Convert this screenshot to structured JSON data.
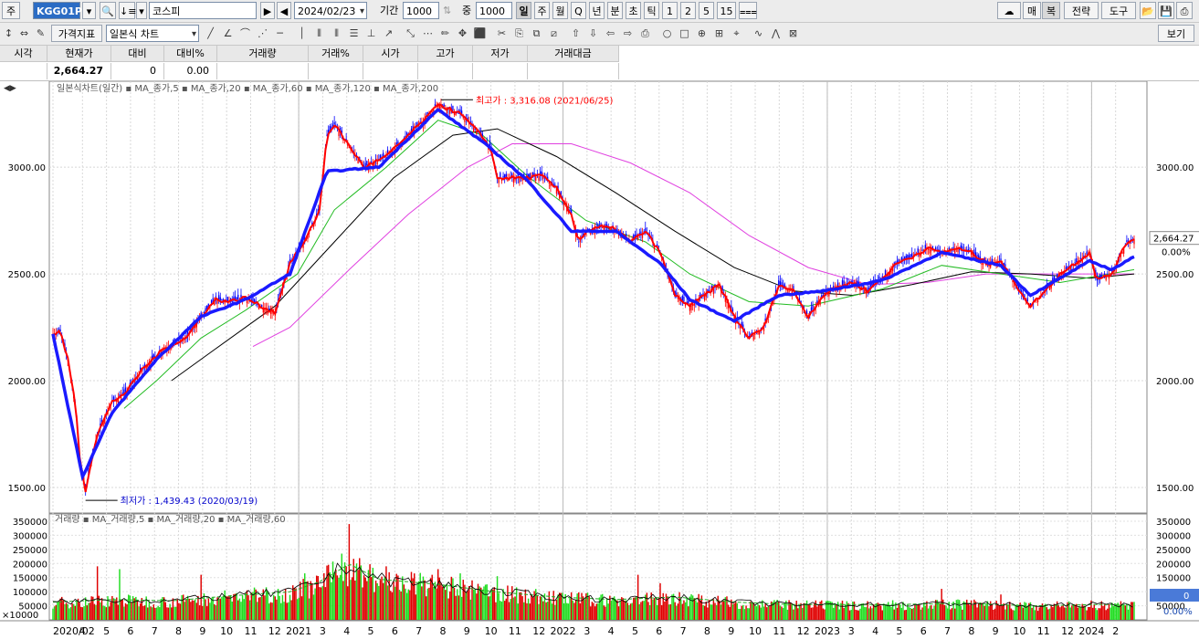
{
  "toolbar": {
    "market_label": "주",
    "code": "KGG01P",
    "name": "코스피",
    "date": "2024/02/23",
    "period_label": "기간",
    "period_value": "1000",
    "count_label": "중",
    "count_value": "1000",
    "interval_tabs": [
      "일",
      "주",
      "월",
      "Q",
      "년",
      "분",
      "초",
      "틱",
      "1",
      "2",
      "5",
      "15"
    ],
    "selected_interval": "일",
    "right_buttons": [
      "매",
      "복",
      "전략",
      "도구"
    ],
    "indicator_button": "가격지표",
    "chart_type": "일본식 차트",
    "saved_button": "보기"
  },
  "price_bar": {
    "headers": [
      "시각",
      "현재가",
      "대비",
      "대비%",
      "거래량",
      "거래%",
      "시가",
      "고가",
      "저가",
      "거래대금"
    ],
    "values": [
      "",
      "2,664.27",
      "0",
      "0.00",
      "",
      "",
      "",
      "",
      "",
      ""
    ]
  },
  "chart_data": [
    {
      "type": "candlestick",
      "legend": "일본식차트(일간) ▪ MA_종가,5 ▪ MA_종가,20 ▪ MA_종가,60 ▪ MA_종가,120 ▪ MA_종가,200",
      "series": [
        {
          "name": "MA_종가,5",
          "color": "#ff0000"
        },
        {
          "name": "MA_종가,20",
          "color": "#ff0000"
        },
        {
          "name": "MA_종가,60",
          "color": "#0000dd"
        },
        {
          "name": "MA_종가,120",
          "color": "#00bb00"
        },
        {
          "name": "MA_종가,200",
          "color": "#000000"
        },
        {
          "name": "",
          "color": "#ff00ff"
        }
      ],
      "ylim": [
        1380,
        3360
      ],
      "yticks": [
        "3000.00",
        "2500.00",
        "2000.00",
        "1500.00"
      ],
      "ytick_values": [
        3000,
        2500,
        2000,
        1500
      ],
      "x_labels": [
        "2020/02",
        "4",
        "5",
        "6",
        "7",
        "8",
        "9",
        "10",
        "11",
        "12",
        "2021",
        "3",
        "4",
        "5",
        "6",
        "7",
        "8",
        "9",
        "10",
        "11",
        "12",
        "2022",
        "3",
        "4",
        "5",
        "6",
        "7",
        "8",
        "9",
        "10",
        "11",
        "12",
        "2023",
        "3",
        "4",
        "5",
        "6",
        "7",
        "8",
        "9",
        "10",
        "11",
        "12",
        "2024",
        "2"
      ],
      "close_path": [
        [
          0,
          2220
        ],
        [
          5,
          2230
        ],
        [
          10,
          2100
        ],
        [
          15,
          1900
        ],
        [
          18,
          1650
        ],
        [
          22,
          1480
        ],
        [
          25,
          1600
        ],
        [
          30,
          1750
        ],
        [
          40,
          1900
        ],
        [
          50,
          1950
        ],
        [
          60,
          2050
        ],
        [
          75,
          2150
        ],
        [
          90,
          2200
        ],
        [
          100,
          2300
        ],
        [
          110,
          2380
        ],
        [
          120,
          2370
        ],
        [
          130,
          2390
        ],
        [
          140,
          2350
        ],
        [
          150,
          2320
        ],
        [
          160,
          2550
        ],
        [
          170,
          2650
        ],
        [
          180,
          2800
        ],
        [
          185,
          3150
        ],
        [
          190,
          3200
        ],
        [
          200,
          3100
        ],
        [
          210,
          3000
        ],
        [
          225,
          3050
        ],
        [
          240,
          3150
        ],
        [
          255,
          3250
        ],
        [
          260,
          3300
        ],
        [
          265,
          3280
        ],
        [
          275,
          3250
        ],
        [
          285,
          3180
        ],
        [
          295,
          3100
        ],
        [
          300,
          2950
        ],
        [
          310,
          2950
        ],
        [
          320,
          2950
        ],
        [
          330,
          2960
        ],
        [
          340,
          2900
        ],
        [
          350,
          2780
        ],
        [
          355,
          2650
        ],
        [
          360,
          2700
        ],
        [
          370,
          2720
        ],
        [
          380,
          2710
        ],
        [
          390,
          2650
        ],
        [
          400,
          2700
        ],
        [
          410,
          2600
        ],
        [
          420,
          2400
        ],
        [
          430,
          2350
        ],
        [
          440,
          2400
        ],
        [
          450,
          2450
        ],
        [
          460,
          2300
        ],
        [
          470,
          2200
        ],
        [
          480,
          2250
        ],
        [
          490,
          2450
        ],
        [
          500,
          2420
        ],
        [
          510,
          2300
        ],
        [
          520,
          2400
        ],
        [
          530,
          2440
        ],
        [
          540,
          2460
        ],
        [
          550,
          2420
        ],
        [
          560,
          2480
        ],
        [
          570,
          2550
        ],
        [
          580,
          2580
        ],
        [
          590,
          2620
        ],
        [
          600,
          2600
        ],
        [
          610,
          2620
        ],
        [
          620,
          2600
        ],
        [
          630,
          2550
        ],
        [
          640,
          2560
        ],
        [
          650,
          2450
        ],
        [
          660,
          2350
        ],
        [
          670,
          2420
        ],
        [
          680,
          2500
        ],
        [
          690,
          2550
        ],
        [
          700,
          2600
        ],
        [
          705,
          2470
        ],
        [
          715,
          2500
        ],
        [
          725,
          2650
        ],
        [
          730,
          2664
        ]
      ],
      "ma20_path": [
        [
          0,
          2220
        ],
        [
          20,
          1550
        ],
        [
          40,
          1850
        ],
        [
          70,
          2100
        ],
        [
          100,
          2300
        ],
        [
          130,
          2380
        ],
        [
          160,
          2500
        ],
        [
          185,
          2980
        ],
        [
          220,
          3000
        ],
        [
          260,
          3270
        ],
        [
          290,
          3120
        ],
        [
          320,
          2940
        ],
        [
          350,
          2700
        ],
        [
          380,
          2700
        ],
        [
          410,
          2550
        ],
        [
          430,
          2380
        ],
        [
          460,
          2280
        ],
        [
          490,
          2400
        ],
        [
          520,
          2420
        ],
        [
          560,
          2470
        ],
        [
          600,
          2600
        ],
        [
          640,
          2540
        ],
        [
          660,
          2400
        ],
        [
          700,
          2560
        ],
        [
          715,
          2520
        ],
        [
          730,
          2580
        ]
      ],
      "ma120_path": [
        [
          48,
          1870
        ],
        [
          70,
          2000
        ],
        [
          100,
          2200
        ],
        [
          130,
          2330
        ],
        [
          165,
          2500
        ],
        [
          190,
          2800
        ],
        [
          225,
          3000
        ],
        [
          260,
          3220
        ],
        [
          290,
          3150
        ],
        [
          320,
          2960
        ],
        [
          360,
          2750
        ],
        [
          400,
          2650
        ],
        [
          430,
          2500
        ],
        [
          470,
          2370
        ],
        [
          510,
          2350
        ],
        [
          560,
          2430
        ],
        [
          600,
          2540
        ],
        [
          640,
          2500
        ],
        [
          680,
          2460
        ],
        [
          730,
          2520
        ]
      ],
      "ma200_path": [
        [
          80,
          2000
        ],
        [
          110,
          2150
        ],
        [
          150,
          2350
        ],
        [
          190,
          2650
        ],
        [
          230,
          2950
        ],
        [
          270,
          3150
        ],
        [
          300,
          3180
        ],
        [
          340,
          3050
        ],
        [
          380,
          2880
        ],
        [
          420,
          2700
        ],
        [
          460,
          2530
        ],
        [
          500,
          2420
        ],
        [
          540,
          2400
        ],
        [
          580,
          2450
        ],
        [
          620,
          2510
        ],
        [
          660,
          2500
        ],
        [
          700,
          2480
        ],
        [
          730,
          2500
        ]
      ],
      "magenta_path": [
        [
          135,
          2160
        ],
        [
          160,
          2250
        ],
        [
          200,
          2520
        ],
        [
          240,
          2780
        ],
        [
          280,
          3000
        ],
        [
          310,
          3110
        ],
        [
          350,
          3110
        ],
        [
          390,
          3020
        ],
        [
          430,
          2880
        ],
        [
          470,
          2680
        ],
        [
          510,
          2530
        ],
        [
          550,
          2450
        ],
        [
          590,
          2460
        ],
        [
          630,
          2500
        ],
        [
          680,
          2500
        ],
        [
          730,
          2500
        ]
      ],
      "annotations": [
        {
          "label": "최고가 : 3,316.08 (2021/06/25)",
          "value": 3316.08,
          "color": "#ff0000"
        },
        {
          "label": "최저가 : 1,439.43 (2020/03/19)",
          "value": 1439.43,
          "color": "#0000cc"
        }
      ],
      "current_price": "2,664.27",
      "current_change": "0.00%"
    },
    {
      "type": "bar",
      "legend": "거래량 ▪ MA_거래량,5 ▪ MA_거래량,20 ▪ MA_거래량,60",
      "ylim": [
        0,
        350000
      ],
      "yticks": [
        "350000",
        "300000",
        "250000",
        "200000",
        "150000",
        "100000",
        "50000"
      ],
      "ytick_values": [
        350000,
        300000,
        250000,
        200000,
        150000,
        100000,
        50000
      ],
      "axis_unit": "×10000",
      "volume_envelope": [
        [
          0,
          70000
        ],
        [
          40,
          80000
        ],
        [
          80,
          75000
        ],
        [
          120,
          95000
        ],
        [
          160,
          110000
        ],
        [
          180,
          150000
        ],
        [
          200,
          220000
        ],
        [
          220,
          160000
        ],
        [
          260,
          140000
        ],
        [
          300,
          110000
        ],
        [
          340,
          90000
        ],
        [
          380,
          80000
        ],
        [
          420,
          90000
        ],
        [
          460,
          70000
        ],
        [
          500,
          60000
        ],
        [
          560,
          60000
        ],
        [
          620,
          65000
        ],
        [
          660,
          55000
        ],
        [
          700,
          60000
        ],
        [
          730,
          60000
        ]
      ],
      "volume_spikes": [
        [
          30,
          190000
        ],
        [
          45,
          180000
        ],
        [
          100,
          160000
        ],
        [
          170,
          165000
        ],
        [
          195,
          235000
        ],
        [
          200,
          340000
        ],
        [
          205,
          200000
        ],
        [
          225,
          190000
        ],
        [
          260,
          180000
        ],
        [
          275,
          165000
        ],
        [
          300,
          155000
        ],
        [
          395,
          160000
        ],
        [
          410,
          130000
        ],
        [
          600,
          110000
        ],
        [
          640,
          90000
        ]
      ],
      "current_value": "0",
      "current_change": "0.00%"
    }
  ]
}
